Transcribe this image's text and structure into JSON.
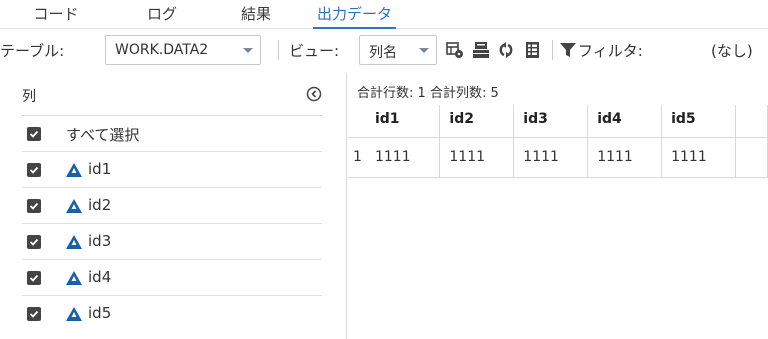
{
  "tabs": [
    {
      "label": "コード",
      "active": false
    },
    {
      "label": "ログ",
      "active": false
    },
    {
      "label": "結果",
      "active": false
    },
    {
      "label": "出力データ",
      "active": true
    }
  ],
  "toolbar": {
    "table_label": "テーブル:",
    "table_value": "WORK.DATA2",
    "view_label": "ビュー:",
    "view_value": "列名",
    "icons": [
      "table-properties-icon",
      "data-save-icon",
      "refresh-icon",
      "column-list-icon"
    ],
    "filter_label": "フィルタ:",
    "filter_value": "(なし)"
  },
  "columns_panel": {
    "header": "列",
    "select_all_label": "すべて選択",
    "columns": [
      {
        "name": "id1",
        "checked": true
      },
      {
        "name": "id2",
        "checked": true
      },
      {
        "name": "id3",
        "checked": true
      },
      {
        "name": "id4",
        "checked": true
      },
      {
        "name": "id5",
        "checked": true
      }
    ]
  },
  "summary": {
    "total_rows_text": "合計行数: 1",
    "total_cols_text": "合計列数: 5"
  },
  "grid": {
    "headers": [
      "id1",
      "id2",
      "id3",
      "id4",
      "id5"
    ],
    "rows": [
      {
        "row_number": "1",
        "cells": [
          "1111",
          "1111",
          "1111",
          "1111",
          "1111"
        ]
      }
    ]
  },
  "colors": {
    "accent": "#2b73c7",
    "checkbox": "#444444",
    "column_icon": "#1a5fa8"
  }
}
